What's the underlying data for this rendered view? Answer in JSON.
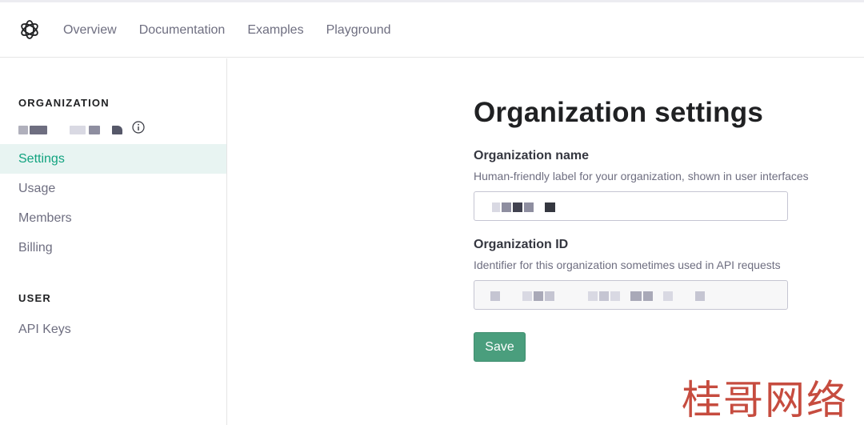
{
  "nav": {
    "links": [
      "Overview",
      "Documentation",
      "Examples",
      "Playground"
    ]
  },
  "sidebar": {
    "organization_title": "ORGANIZATION",
    "items": [
      "Settings",
      "Usage",
      "Members",
      "Billing"
    ],
    "active_item": "Settings",
    "user_title": "USER",
    "user_items": [
      "API Keys"
    ]
  },
  "main": {
    "title": "Organization settings",
    "org_name_label": "Organization name",
    "org_name_help": "Human-friendly label for your organization, shown in user interfaces",
    "org_id_label": "Organization ID",
    "org_id_help": "Identifier for this organization sometimes used in API requests",
    "save_label": "Save"
  },
  "watermark": "桂哥网络",
  "colors": {
    "accent": "#10a37f",
    "active_bg": "#e8f4f2",
    "save_button": "#4a9e7d"
  },
  "icons": [
    "openai-logo-icon",
    "info-icon"
  ]
}
